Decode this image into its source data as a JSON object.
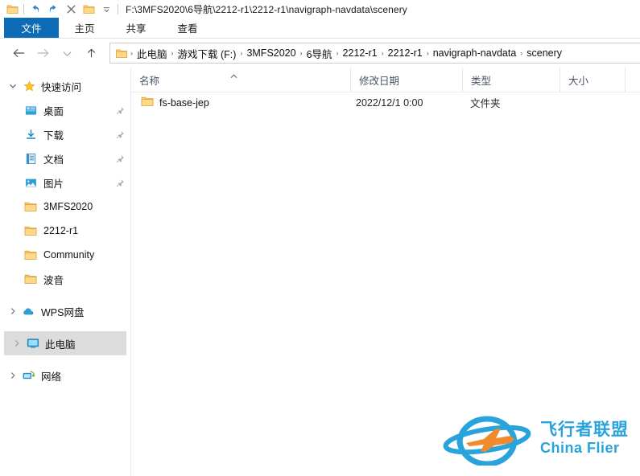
{
  "window": {
    "title_path": "F:\\3MFS2020\\6导航\\2212-r1\\2212-r1\\navigraph-navdata\\scenery"
  },
  "quick_access_toolbar": {
    "items": [
      {
        "name": "folder-icon",
        "label": ""
      },
      {
        "name": "undo-icon",
        "label": ""
      },
      {
        "name": "redo-icon",
        "label": ""
      },
      {
        "name": "delete-icon",
        "label": ""
      },
      {
        "name": "new-folder-icon",
        "label": ""
      },
      {
        "name": "chevron-down-icon",
        "label": ""
      }
    ]
  },
  "ribbon": {
    "tabs": [
      {
        "label": "文件",
        "selected": true
      },
      {
        "label": "主页",
        "selected": false
      },
      {
        "label": "共享",
        "selected": false
      },
      {
        "label": "查看",
        "selected": false
      }
    ]
  },
  "navbar": {
    "back_label": "←",
    "forward_label": "→",
    "recent_label": "⌄",
    "up_label": "↑",
    "breadcrumbs": [
      "此电脑",
      "游戏下载 (F:)",
      "3MFS2020",
      "6导航",
      "2212-r1",
      "2212-r1",
      "navigraph-navdata",
      "scenery"
    ],
    "separator": "›"
  },
  "sidebar": {
    "items": [
      {
        "label": "快速访问",
        "icon": "star-icon",
        "level": 0,
        "chevron": "expanded",
        "pinned": false,
        "selected": false
      },
      {
        "label": "桌面",
        "icon": "desktop-icon",
        "level": 1,
        "chevron": "none",
        "pinned": true,
        "selected": false
      },
      {
        "label": "下载",
        "icon": "download-icon",
        "level": 1,
        "chevron": "none",
        "pinned": true,
        "selected": false
      },
      {
        "label": "文档",
        "icon": "documents-icon",
        "level": 1,
        "chevron": "none",
        "pinned": true,
        "selected": false
      },
      {
        "label": "图片",
        "icon": "pictures-icon",
        "level": 1,
        "chevron": "none",
        "pinned": true,
        "selected": false
      },
      {
        "label": "3MFS2020",
        "icon": "folder-icon",
        "level": 1,
        "chevron": "none",
        "pinned": false,
        "selected": false
      },
      {
        "label": "2212-r1",
        "icon": "folder-icon",
        "level": 1,
        "chevron": "none",
        "pinned": false,
        "selected": false
      },
      {
        "label": "Community",
        "icon": "folder-icon",
        "level": 1,
        "chevron": "none",
        "pinned": false,
        "selected": false
      },
      {
        "label": "波音",
        "icon": "folder-icon",
        "level": 1,
        "chevron": "none",
        "pinned": false,
        "selected": false
      },
      {
        "label": "WPS网盘",
        "icon": "cloud-icon",
        "level": 0,
        "chevron": "collapsed",
        "pinned": false,
        "selected": false
      },
      {
        "label": "此电脑",
        "icon": "pc-icon",
        "level": 0,
        "chevron": "collapsed",
        "pinned": false,
        "selected": true
      },
      {
        "label": "网络",
        "icon": "network-icon",
        "level": 0,
        "chevron": "collapsed",
        "pinned": false,
        "selected": false
      }
    ]
  },
  "file_list": {
    "columns": [
      {
        "label": "名称",
        "sorted": "asc"
      },
      {
        "label": "修改日期",
        "sorted": "none"
      },
      {
        "label": "类型",
        "sorted": "none"
      },
      {
        "label": "大小",
        "sorted": "none"
      }
    ],
    "rows": [
      {
        "name": "fs-base-jep",
        "modified": "2022/12/1 0:00",
        "type": "文件夹",
        "size": "",
        "icon": "folder-icon"
      }
    ]
  },
  "watermark": {
    "cn": "飞行者联盟",
    "en": "China Flier",
    "color": "#29a3dc",
    "plane_color": "#f08a2c"
  },
  "colors": {
    "accent": "#0d6cb5",
    "folder_yellow": "#ffc95b",
    "selection_gray": "#dcdcdc",
    "header_text": "#4a5568"
  }
}
